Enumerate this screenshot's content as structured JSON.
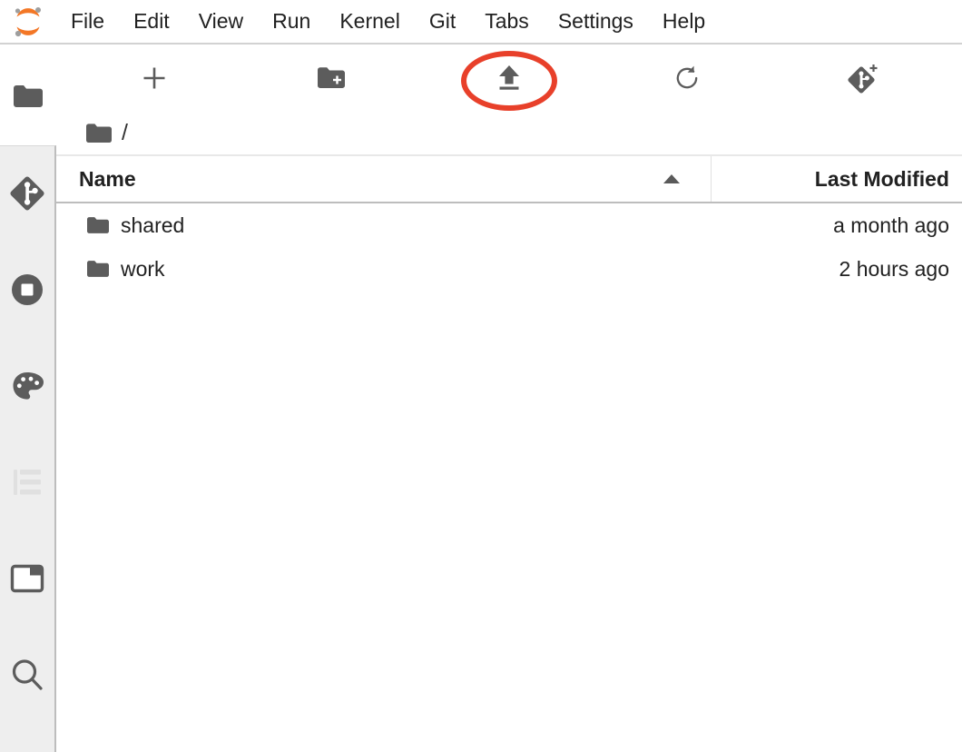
{
  "app": {
    "logo_icon": "jupyter-logo",
    "accent_color": "#f37726",
    "annotation_color": "#e8402a"
  },
  "menubar": {
    "items": [
      {
        "label": "File"
      },
      {
        "label": "Edit"
      },
      {
        "label": "View"
      },
      {
        "label": "Run"
      },
      {
        "label": "Kernel"
      },
      {
        "label": "Git"
      },
      {
        "label": "Tabs"
      },
      {
        "label": "Settings"
      },
      {
        "label": "Help"
      }
    ]
  },
  "sidebar": {
    "items": [
      {
        "name": "file-browser",
        "icon": "folder-icon",
        "active": true,
        "enabled": true
      },
      {
        "name": "git",
        "icon": "git-icon",
        "active": false,
        "enabled": true
      },
      {
        "name": "running-terminals-kernels",
        "icon": "stop-square-icon",
        "active": false,
        "enabled": true
      },
      {
        "name": "extension-manager",
        "icon": "palette-icon",
        "active": false,
        "enabled": true
      },
      {
        "name": "table-of-contents",
        "icon": "toc-icon",
        "active": false,
        "enabled": false
      },
      {
        "name": "open-tabs",
        "icon": "window-icon",
        "active": false,
        "enabled": true
      },
      {
        "name": "search",
        "icon": "search-icon",
        "active": false,
        "enabled": true
      }
    ]
  },
  "toolbar": {
    "buttons": [
      {
        "name": "new-launcher",
        "icon": "plus-icon",
        "title": "New Launcher"
      },
      {
        "name": "new-folder",
        "icon": "folder-plus-icon",
        "title": "New Folder"
      },
      {
        "name": "upload-files",
        "icon": "upload-icon",
        "title": "Upload Files",
        "highlighted": true
      },
      {
        "name": "refresh-file-list",
        "icon": "refresh-icon",
        "title": "Refresh File List"
      },
      {
        "name": "git-clone",
        "icon": "git-clone-icon",
        "title": "Git Clone"
      }
    ]
  },
  "breadcrumb": {
    "root_icon": "folder-icon",
    "separator": "/"
  },
  "file_browser": {
    "columns": [
      {
        "key": "name",
        "label": "Name",
        "sorted": true,
        "sort_direction": "ascending"
      },
      {
        "key": "last_modified",
        "label": "Last Modified"
      }
    ],
    "rows": [
      {
        "icon": "folder-icon",
        "name": "shared",
        "last_modified": "a month ago"
      },
      {
        "icon": "folder-icon",
        "name": "work",
        "last_modified": "2 hours ago"
      }
    ]
  }
}
